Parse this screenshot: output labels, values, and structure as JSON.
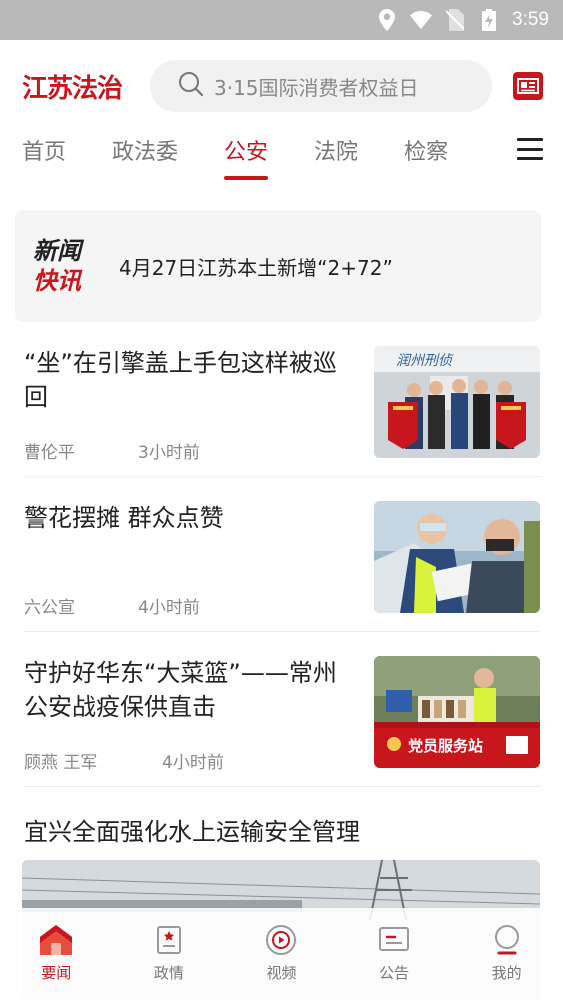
{
  "status_bar": {
    "time": "3:59"
  },
  "header": {
    "logo": "江苏法治",
    "search_placeholder": "3·15国际消费者权益日"
  },
  "tabs": [
    {
      "label": "首页",
      "active": false
    },
    {
      "label": "政法委",
      "active": false
    },
    {
      "label": "公安",
      "active": true
    },
    {
      "label": "法院",
      "active": false
    },
    {
      "label": "检察",
      "active": false
    }
  ],
  "flash": {
    "logo_line1": "新闻",
    "logo_line2": "快讯",
    "text": "4月27日江苏本土新增“2+72”"
  },
  "news": [
    {
      "title": "“坐”在引擎盖上手包这样被巡回",
      "author": "曹伦平",
      "time": "3小时前"
    },
    {
      "title": "警花摆摊 群众点赞",
      "author": "六公宣",
      "time": "4小时前"
    },
    {
      "title": "守护好华东“大菜篮”——常州公安战疫保供直击",
      "author": "顾燕 王军",
      "time": "4小时前"
    }
  ],
  "thumb_texts": {
    "banner": "润州刑侦",
    "booth": "党员服务站"
  },
  "featured": {
    "title": "宜兴全面强化水上运输安全管理"
  },
  "bottom_nav": [
    {
      "label": "要闻",
      "icon": "home-icon",
      "active": true
    },
    {
      "label": "政情",
      "icon": "bookmark-doc-icon",
      "active": false
    },
    {
      "label": "视频",
      "icon": "video-play-icon",
      "active": false
    },
    {
      "label": "公告",
      "icon": "notice-icon",
      "active": false
    },
    {
      "label": "我的",
      "icon": "profile-icon",
      "active": false
    }
  ],
  "colors": {
    "brand_red": "#c8161d",
    "status_bar": "#b9b9b9"
  }
}
